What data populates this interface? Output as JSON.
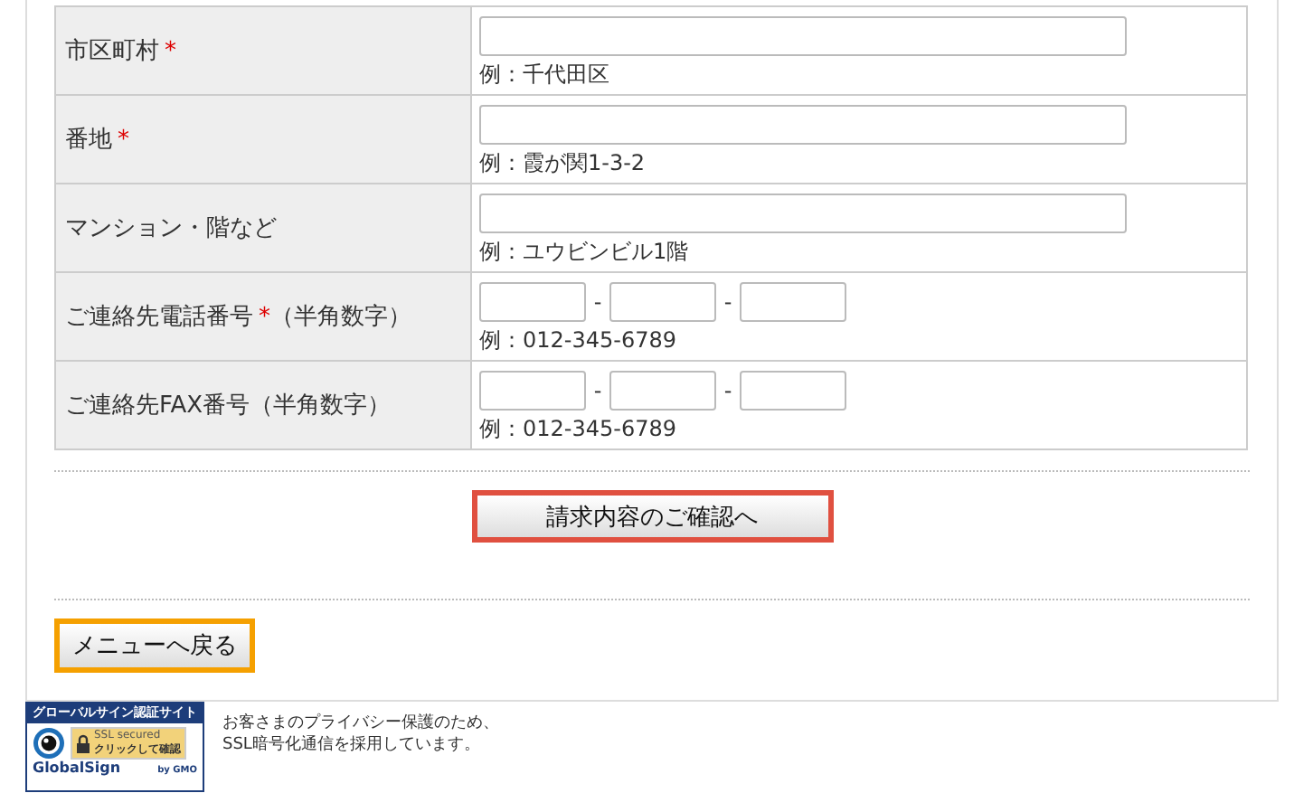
{
  "form_rows": [
    {
      "label": "市区町村",
      "required": true,
      "suffix": "",
      "kind": "text",
      "example": "例：千代田区"
    },
    {
      "label": "番地",
      "required": true,
      "suffix": "",
      "kind": "text",
      "example": "例：霞が関1-3-2"
    },
    {
      "label": "マンション・階など",
      "required": false,
      "suffix": "",
      "kind": "text",
      "example": "例：ユウビンビル1階"
    },
    {
      "label": "ご連絡先電話番号",
      "required": true,
      "suffix": "（半角数字）",
      "kind": "phone",
      "separators": [
        "-",
        "-"
      ],
      "example": "例：012-345-6789"
    },
    {
      "label": "ご連絡先FAX番号",
      "required": false,
      "suffix": "（半角数字）",
      "kind": "phone",
      "separators": [
        "-",
        "-"
      ],
      "example": "例：012-345-6789"
    }
  ],
  "required_mark": "*",
  "confirm_button": "請求内容のご確認へ",
  "back_button": "メニューへ戻る",
  "ssl_badge": {
    "header": "グローバルサイン認証サイト",
    "secured": "SSL secured",
    "check": "クリックして確認",
    "brand": "GlobalSign",
    "by": "by GMO"
  },
  "privacy_note": [
    "お客さまのプライバシー保護のため、",
    "SSL暗号化通信を採用しています。"
  ]
}
